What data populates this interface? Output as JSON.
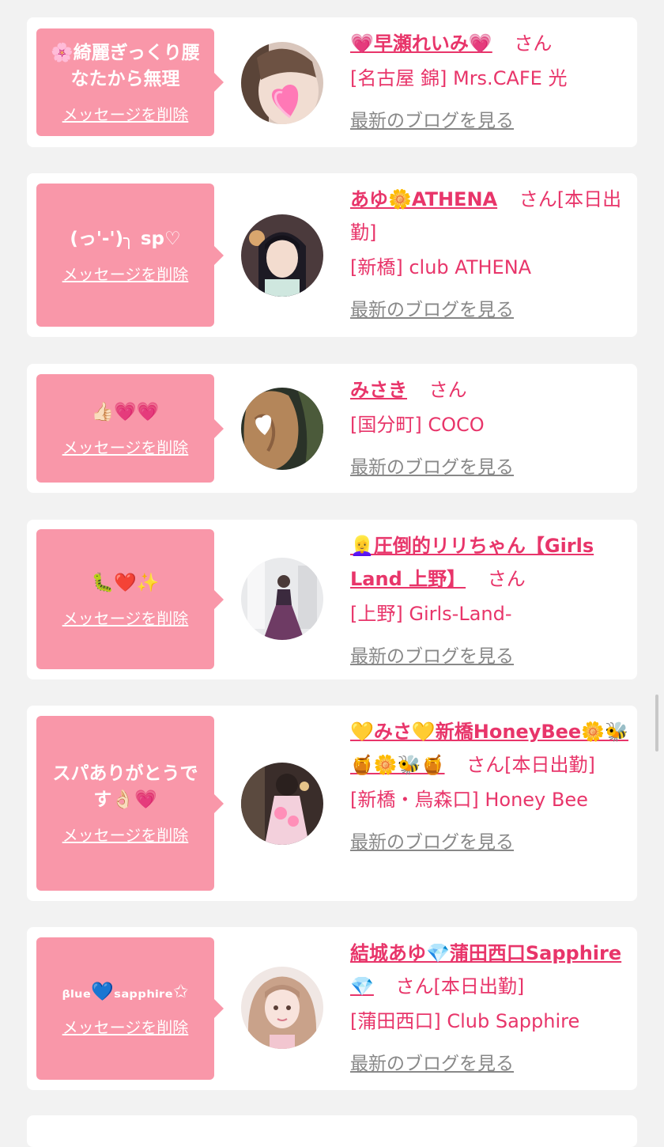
{
  "cards": [
    {
      "message": "🌸綺麗ぎっくり腰なたから無理",
      "delete_label": "メッセージを削除",
      "name": "💗早瀬れいみ💗",
      "honorific": "さん",
      "shop": "[名古屋 錦] Mrs.CAFE 光",
      "blog_label": "最新のブログを見る",
      "avatar": "pink-heart-face-avatar"
    },
    {
      "message": "(っ'-')╮ sp♡",
      "delete_label": "メッセージを削除",
      "name": "あゆ🌼ATHENA",
      "honorific": "さん[本日出勤]",
      "shop": "[新橋] club ATHENA",
      "blog_label": "最新のブログを見る",
      "avatar": "dark-hair-girl-avatar"
    },
    {
      "message": "👍🏻💗💗",
      "delete_label": "メッセージを削除",
      "name": "みさき",
      "honorific": "さん",
      "shop": "[国分町] COCO",
      "blog_label": "最新のブログを見る",
      "avatar": "wavy-hair-avatar"
    },
    {
      "message": "🐛❤️✨",
      "delete_label": "メッセージを削除",
      "name": "👱‍♀️圧倒的リリちゃん【Girls Land 上野】",
      "honorific": "さん",
      "shop": "[上野] Girls-Land-",
      "blog_label": "最新のブログを見る",
      "avatar": "purple-dress-avatar"
    },
    {
      "message": "スパありがとうです👌🏻💗",
      "delete_label": "メッセージを削除",
      "name": "💛みさ💛新橋HoneyBee🌼🐝🍯🌼🐝🍯",
      "honorific": "さん[本日出勤]",
      "shop": "[新橋・烏森口] Honey Bee",
      "blog_label": "最新のブログを見る",
      "avatar": "pink-outfit-avatar"
    },
    {
      "message": "ᵦₗᵤₑ💙ₛₐₚₚₕᵢᵣₑ✩",
      "delete_label": "メッセージを削除",
      "name": "結城あゆ💎蒲田西口Sapphire💎",
      "honorific": "さん[本日出勤]",
      "shop": "[蒲田西口] Club Sapphire",
      "blog_label": "最新のブログを見る",
      "avatar": "blonde-girl-avatar"
    }
  ]
}
